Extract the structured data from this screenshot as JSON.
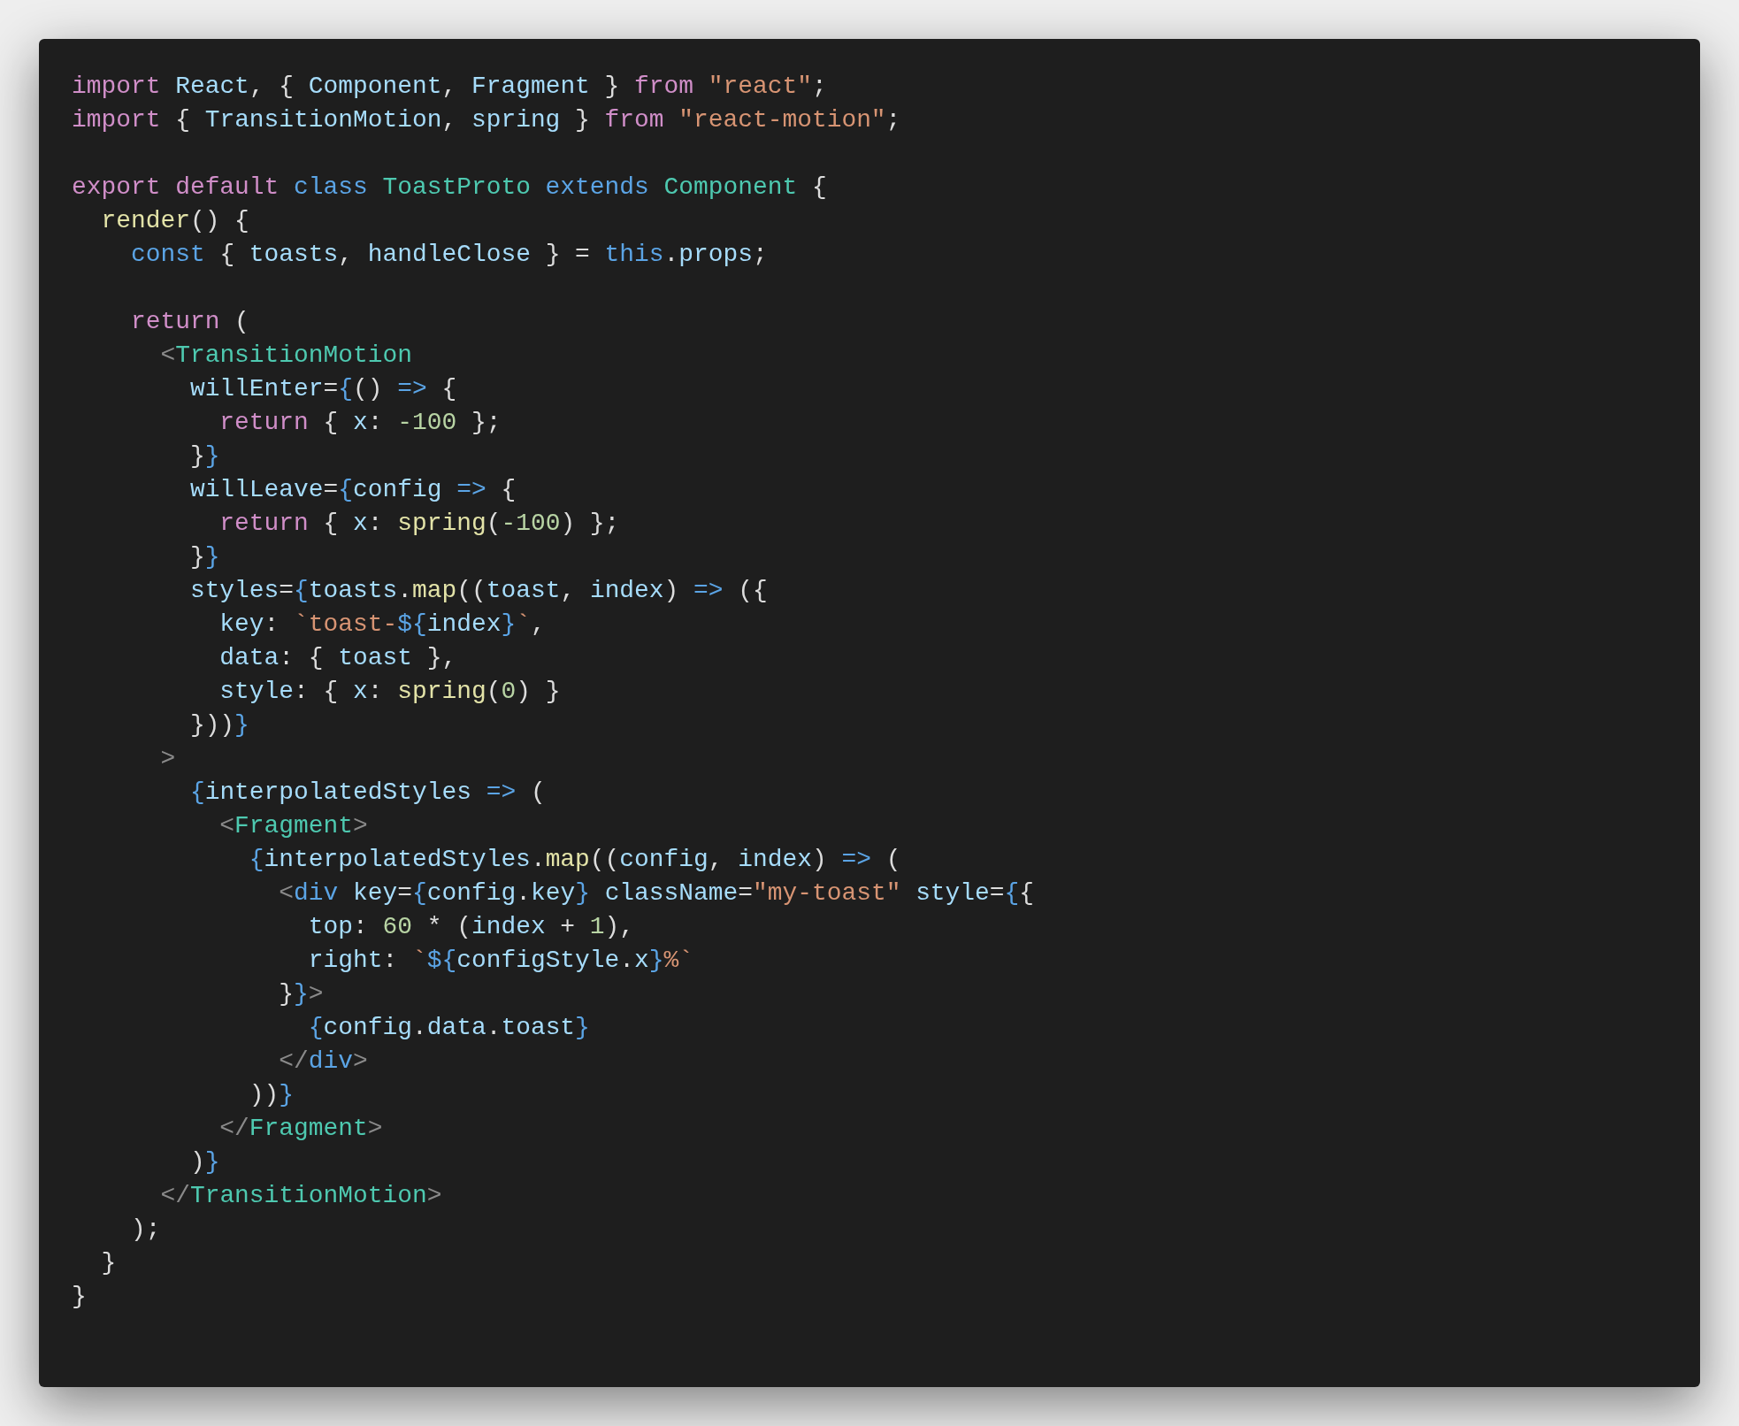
{
  "code_lines": [
    {
      "kind": "code",
      "tokens": [
        {
          "text": "import",
          "kind": "kw"
        },
        {
          "text": " React",
          "kind": "va"
        },
        {
          "text": ", { ",
          "kind": "p"
        },
        {
          "text": "Component",
          "kind": "va"
        },
        {
          "text": ", ",
          "kind": "p"
        },
        {
          "text": "Fragment",
          "kind": "va"
        },
        {
          "text": " } ",
          "kind": "p"
        },
        {
          "text": "from",
          "kind": "kw"
        },
        {
          "text": " \"react\"",
          "kind": "str"
        },
        {
          "text": ";",
          "kind": "p"
        }
      ]
    },
    {
      "kind": "code",
      "tokens": [
        {
          "text": "import",
          "kind": "kw"
        },
        {
          "text": " { ",
          "kind": "p"
        },
        {
          "text": "TransitionMotion",
          "kind": "va"
        },
        {
          "text": ", ",
          "kind": "p"
        },
        {
          "text": "spring",
          "kind": "va"
        },
        {
          "text": " } ",
          "kind": "p"
        },
        {
          "text": "from",
          "kind": "kw"
        },
        {
          "text": " \"react-motion\"",
          "kind": "str"
        },
        {
          "text": ";",
          "kind": "p"
        }
      ]
    },
    {
      "kind": "blank"
    },
    {
      "kind": "code",
      "tokens": [
        {
          "text": "export default ",
          "kind": "kw"
        },
        {
          "text": "class ",
          "kind": "st"
        },
        {
          "text": "ToastProto ",
          "kind": "ty"
        },
        {
          "text": "extends ",
          "kind": "st"
        },
        {
          "text": "Component",
          "kind": "ty"
        },
        {
          "text": " {",
          "kind": "p"
        }
      ]
    },
    {
      "kind": "code",
      "tokens": [
        {
          "text": "  render",
          "kind": "fn"
        },
        {
          "text": "() {",
          "kind": "p"
        }
      ]
    },
    {
      "kind": "code",
      "tokens": [
        {
          "text": "    const",
          "kind": "st"
        },
        {
          "text": " { ",
          "kind": "p"
        },
        {
          "text": "toasts",
          "kind": "va"
        },
        {
          "text": ", ",
          "kind": "p"
        },
        {
          "text": "handleClose",
          "kind": "va"
        },
        {
          "text": " } = ",
          "kind": "p"
        },
        {
          "text": "this",
          "kind": "st"
        },
        {
          "text": ".",
          "kind": "p"
        },
        {
          "text": "props",
          "kind": "va"
        },
        {
          "text": ";",
          "kind": "p"
        }
      ]
    },
    {
      "kind": "blank"
    },
    {
      "kind": "code",
      "tokens": [
        {
          "text": "    return",
          "kind": "kw"
        },
        {
          "text": " (",
          "kind": "p"
        }
      ]
    },
    {
      "kind": "code",
      "tokens": [
        {
          "text": "      <",
          "kind": "tag"
        },
        {
          "text": "TransitionMotion",
          "kind": "ty"
        }
      ]
    },
    {
      "kind": "code",
      "tokens": [
        {
          "text": "        willEnter",
          "kind": "va"
        },
        {
          "text": "=",
          "kind": "p"
        },
        {
          "text": "{",
          "kind": "br"
        },
        {
          "text": "() ",
          "kind": "p"
        },
        {
          "text": "=>",
          "kind": "br"
        },
        {
          "text": " {",
          "kind": "p"
        }
      ]
    },
    {
      "kind": "code",
      "tokens": [
        {
          "text": "          return",
          "kind": "kw"
        },
        {
          "text": " { ",
          "kind": "p"
        },
        {
          "text": "x",
          "kind": "va"
        },
        {
          "text": ": ",
          "kind": "p"
        },
        {
          "text": "-100",
          "kind": "num"
        },
        {
          "text": " };",
          "kind": "p"
        }
      ]
    },
    {
      "kind": "code",
      "tokens": [
        {
          "text": "        }",
          "kind": "p"
        },
        {
          "text": "}",
          "kind": "br"
        }
      ]
    },
    {
      "kind": "code",
      "tokens": [
        {
          "text": "        willLeave",
          "kind": "va"
        },
        {
          "text": "=",
          "kind": "p"
        },
        {
          "text": "{",
          "kind": "br"
        },
        {
          "text": "config ",
          "kind": "va"
        },
        {
          "text": "=>",
          "kind": "br"
        },
        {
          "text": " {",
          "kind": "p"
        }
      ]
    },
    {
      "kind": "code",
      "tokens": [
        {
          "text": "          return",
          "kind": "kw"
        },
        {
          "text": " { ",
          "kind": "p"
        },
        {
          "text": "x",
          "kind": "va"
        },
        {
          "text": ": ",
          "kind": "p"
        },
        {
          "text": "spring",
          "kind": "fn"
        },
        {
          "text": "(",
          "kind": "p"
        },
        {
          "text": "-100",
          "kind": "num"
        },
        {
          "text": ") };",
          "kind": "p"
        }
      ]
    },
    {
      "kind": "code",
      "tokens": [
        {
          "text": "        }",
          "kind": "p"
        },
        {
          "text": "}",
          "kind": "br"
        }
      ]
    },
    {
      "kind": "code",
      "tokens": [
        {
          "text": "        styles",
          "kind": "va"
        },
        {
          "text": "=",
          "kind": "p"
        },
        {
          "text": "{",
          "kind": "br"
        },
        {
          "text": "toasts",
          "kind": "va"
        },
        {
          "text": ".",
          "kind": "p"
        },
        {
          "text": "map",
          "kind": "fn"
        },
        {
          "text": "((",
          "kind": "p"
        },
        {
          "text": "toast",
          "kind": "va"
        },
        {
          "text": ", ",
          "kind": "p"
        },
        {
          "text": "index",
          "kind": "va"
        },
        {
          "text": ") ",
          "kind": "p"
        },
        {
          "text": "=>",
          "kind": "br"
        },
        {
          "text": " ({",
          "kind": "p"
        }
      ]
    },
    {
      "kind": "code",
      "tokens": [
        {
          "text": "          key",
          "kind": "va"
        },
        {
          "text": ": ",
          "kind": "p"
        },
        {
          "text": "`toast-",
          "kind": "str"
        },
        {
          "text": "${",
          "kind": "br"
        },
        {
          "text": "index",
          "kind": "va"
        },
        {
          "text": "}",
          "kind": "br"
        },
        {
          "text": "`",
          "kind": "str"
        },
        {
          "text": ",",
          "kind": "p"
        }
      ]
    },
    {
      "kind": "code",
      "tokens": [
        {
          "text": "          data",
          "kind": "va"
        },
        {
          "text": ": { ",
          "kind": "p"
        },
        {
          "text": "toast",
          "kind": "va"
        },
        {
          "text": " },",
          "kind": "p"
        }
      ]
    },
    {
      "kind": "code",
      "tokens": [
        {
          "text": "          style",
          "kind": "va"
        },
        {
          "text": ": { ",
          "kind": "p"
        },
        {
          "text": "x",
          "kind": "va"
        },
        {
          "text": ": ",
          "kind": "p"
        },
        {
          "text": "spring",
          "kind": "fn"
        },
        {
          "text": "(",
          "kind": "p"
        },
        {
          "text": "0",
          "kind": "num"
        },
        {
          "text": ") }",
          "kind": "p"
        }
      ]
    },
    {
      "kind": "code",
      "tokens": [
        {
          "text": "        }))",
          "kind": "p"
        },
        {
          "text": "}",
          "kind": "br"
        }
      ]
    },
    {
      "kind": "code",
      "tokens": [
        {
          "text": "      >",
          "kind": "tag"
        }
      ]
    },
    {
      "kind": "code",
      "tokens": [
        {
          "text": "        {",
          "kind": "br"
        },
        {
          "text": "interpolatedStyles",
          "kind": "va"
        },
        {
          "text": " =>",
          "kind": "br"
        },
        {
          "text": " (",
          "kind": "p"
        }
      ]
    },
    {
      "kind": "code",
      "tokens": [
        {
          "text": "          <",
          "kind": "tag"
        },
        {
          "text": "Fragment",
          "kind": "ty"
        },
        {
          "text": ">",
          "kind": "tag"
        }
      ]
    },
    {
      "kind": "code",
      "tokens": [
        {
          "text": "            {",
          "kind": "br"
        },
        {
          "text": "interpolatedStyles",
          "kind": "va"
        },
        {
          "text": ".",
          "kind": "p"
        },
        {
          "text": "map",
          "kind": "fn"
        },
        {
          "text": "((",
          "kind": "p"
        },
        {
          "text": "config",
          "kind": "va"
        },
        {
          "text": ", ",
          "kind": "p"
        },
        {
          "text": "index",
          "kind": "va"
        },
        {
          "text": ") ",
          "kind": "p"
        },
        {
          "text": "=>",
          "kind": "br"
        },
        {
          "text": " (",
          "kind": "p"
        }
      ]
    },
    {
      "kind": "code",
      "tokens": [
        {
          "text": "              <",
          "kind": "tag"
        },
        {
          "text": "div",
          "kind": "st"
        },
        {
          "text": " key",
          "kind": "va"
        },
        {
          "text": "=",
          "kind": "p"
        },
        {
          "text": "{",
          "kind": "br"
        },
        {
          "text": "config",
          "kind": "va"
        },
        {
          "text": ".",
          "kind": "p"
        },
        {
          "text": "key",
          "kind": "va"
        },
        {
          "text": "}",
          "kind": "br"
        },
        {
          "text": " className",
          "kind": "va"
        },
        {
          "text": "=",
          "kind": "p"
        },
        {
          "text": "\"my-toast\"",
          "kind": "str"
        },
        {
          "text": " style",
          "kind": "va"
        },
        {
          "text": "=",
          "kind": "p"
        },
        {
          "text": "{",
          "kind": "br"
        },
        {
          "text": "{",
          "kind": "p"
        }
      ]
    },
    {
      "kind": "code",
      "tokens": [
        {
          "text": "                top",
          "kind": "va"
        },
        {
          "text": ": ",
          "kind": "p"
        },
        {
          "text": "60",
          "kind": "num"
        },
        {
          "text": " * (",
          "kind": "p"
        },
        {
          "text": "index",
          "kind": "va"
        },
        {
          "text": " + ",
          "kind": "p"
        },
        {
          "text": "1",
          "kind": "num"
        },
        {
          "text": "),",
          "kind": "p"
        }
      ]
    },
    {
      "kind": "code",
      "tokens": [
        {
          "text": "                right",
          "kind": "va"
        },
        {
          "text": ": ",
          "kind": "p"
        },
        {
          "text": "`",
          "kind": "str"
        },
        {
          "text": "${",
          "kind": "br"
        },
        {
          "text": "configStyle",
          "kind": "va"
        },
        {
          "text": ".",
          "kind": "p"
        },
        {
          "text": "x",
          "kind": "va"
        },
        {
          "text": "}",
          "kind": "br"
        },
        {
          "text": "%`",
          "kind": "str"
        }
      ]
    },
    {
      "kind": "code",
      "tokens": [
        {
          "text": "              }",
          "kind": "p"
        },
        {
          "text": "}",
          "kind": "br"
        },
        {
          "text": ">",
          "kind": "tag"
        }
      ]
    },
    {
      "kind": "code",
      "tokens": [
        {
          "text": "                {",
          "kind": "br"
        },
        {
          "text": "config",
          "kind": "va"
        },
        {
          "text": ".",
          "kind": "p"
        },
        {
          "text": "data",
          "kind": "va"
        },
        {
          "text": ".",
          "kind": "p"
        },
        {
          "text": "toast",
          "kind": "va"
        },
        {
          "text": "}",
          "kind": "br"
        }
      ]
    },
    {
      "kind": "code",
      "tokens": [
        {
          "text": "              </",
          "kind": "tag"
        },
        {
          "text": "div",
          "kind": "st"
        },
        {
          "text": ">",
          "kind": "tag"
        }
      ]
    },
    {
      "kind": "code",
      "tokens": [
        {
          "text": "            ))",
          "kind": "p"
        },
        {
          "text": "}",
          "kind": "br"
        }
      ]
    },
    {
      "kind": "code",
      "tokens": [
        {
          "text": "          </",
          "kind": "tag"
        },
        {
          "text": "Fragment",
          "kind": "ty"
        },
        {
          "text": ">",
          "kind": "tag"
        }
      ]
    },
    {
      "kind": "code",
      "tokens": [
        {
          "text": "        )",
          "kind": "p"
        },
        {
          "text": "}",
          "kind": "br"
        }
      ]
    },
    {
      "kind": "code",
      "tokens": [
        {
          "text": "      </",
          "kind": "tag"
        },
        {
          "text": "TransitionMotion",
          "kind": "ty"
        },
        {
          "text": ">",
          "kind": "tag"
        }
      ]
    },
    {
      "kind": "code",
      "tokens": [
        {
          "text": "    );",
          "kind": "p"
        }
      ]
    },
    {
      "kind": "code",
      "tokens": [
        {
          "text": "  }",
          "kind": "p"
        }
      ]
    },
    {
      "kind": "code",
      "tokens": [
        {
          "text": "}",
          "kind": "p"
        }
      ]
    }
  ]
}
